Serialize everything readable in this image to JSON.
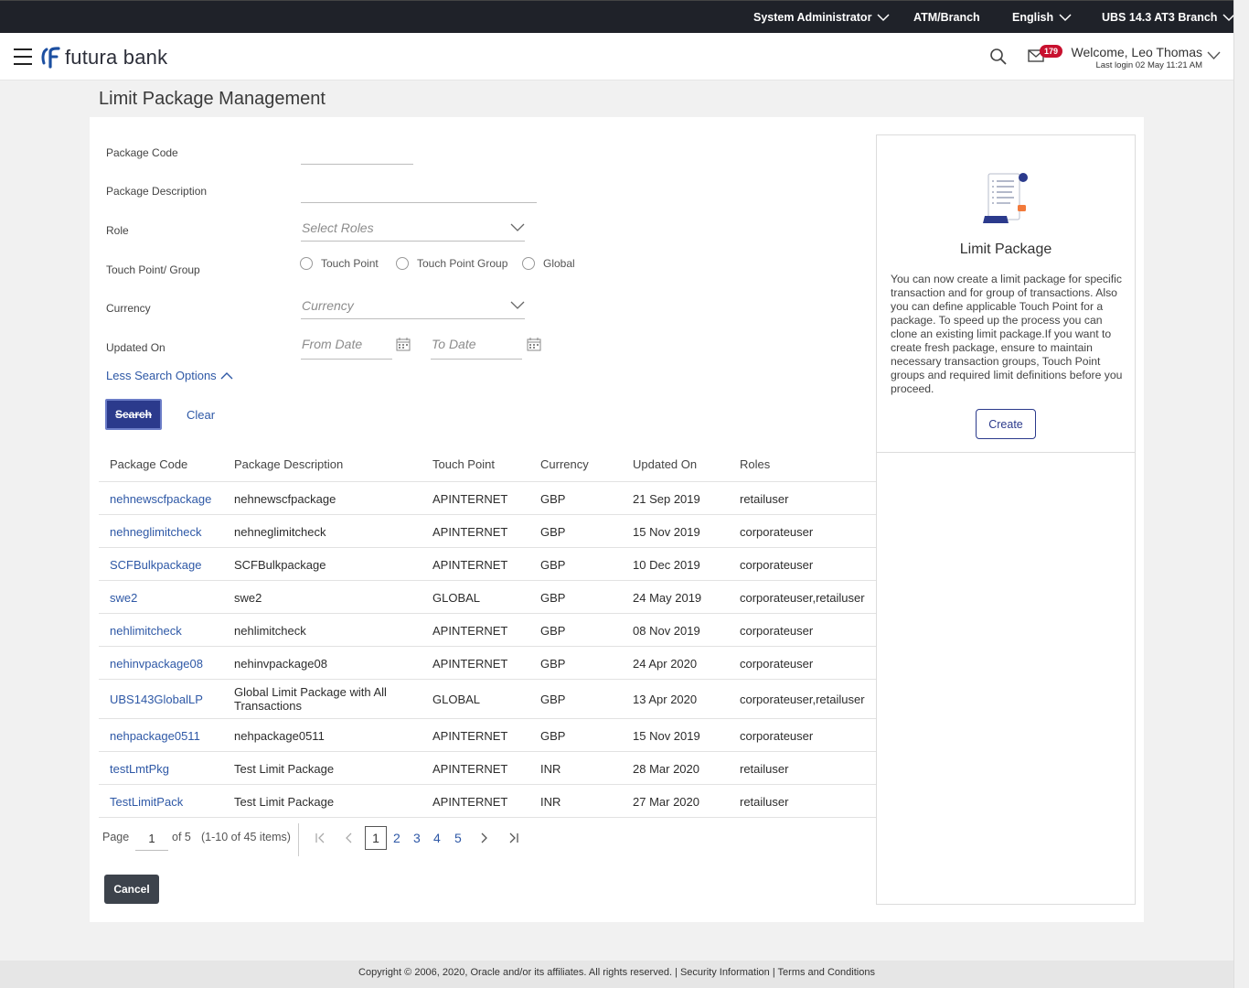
{
  "topbar": {
    "role": "System Administrator",
    "atm_branch": "ATM/Branch",
    "language": "English",
    "branch": "UBS 14.3 AT3 Branch"
  },
  "header": {
    "brand": "futura bank",
    "mail_count": "179",
    "welcome": "Welcome, Leo Thomas",
    "last_login": "Last login 02 May 11:21 AM"
  },
  "page": {
    "title": "Limit Package Management"
  },
  "form": {
    "package_code_label": "Package Code",
    "package_code_value": "",
    "package_desc_label": "Package Description",
    "package_desc_value": "",
    "role_label": "Role",
    "role_placeholder": "Select Roles",
    "touch_point_label": "Touch Point/ Group",
    "touch_point_options": [
      "Touch Point",
      "Touch Point Group",
      "Global"
    ],
    "currency_label": "Currency",
    "currency_placeholder": "Currency",
    "updated_on_label": "Updated On",
    "from_date_placeholder": "From Date",
    "to_date_placeholder": "To Date",
    "less_options": "Less Search Options",
    "search_btn": "Search",
    "clear_btn": "Clear"
  },
  "table": {
    "headers": [
      "Package Code",
      "Package Description",
      "Touch Point",
      "Currency",
      "Updated On",
      "Roles"
    ],
    "rows": [
      [
        "nehnewscfpackage",
        "nehnewscfpackage",
        "APINTERNET",
        "GBP",
        "21 Sep 2019",
        "retailuser"
      ],
      [
        "nehneglimitcheck",
        "nehneglimitcheck",
        "APINTERNET",
        "GBP",
        "15 Nov 2019",
        "corporateuser"
      ],
      [
        "SCFBulkpackage",
        "SCFBulkpackage",
        "APINTERNET",
        "GBP",
        "10 Dec 2019",
        "corporateuser"
      ],
      [
        "swe2",
        "swe2",
        "GLOBAL",
        "GBP",
        "24 May 2019",
        "corporateuser,retailuser"
      ],
      [
        "nehlimitcheck",
        "nehlimitcheck",
        "APINTERNET",
        "GBP",
        "08 Nov 2019",
        "corporateuser"
      ],
      [
        "nehinvpackage08",
        "nehinvpackage08",
        "APINTERNET",
        "GBP",
        "24 Apr 2020",
        "corporateuser"
      ],
      [
        "UBS143GlobalLP",
        "Global Limit Package with All Transactions",
        "GLOBAL",
        "GBP",
        "13 Apr 2020",
        "corporateuser,retailuser"
      ],
      [
        "nehpackage0511",
        "nehpackage0511",
        "APINTERNET",
        "GBP",
        "15 Nov 2019",
        "corporateuser"
      ],
      [
        "testLmtPkg",
        "Test Limit Package",
        "APINTERNET",
        "INR",
        "28 Mar 2020",
        "retailuser"
      ],
      [
        "TestLimitPack",
        "Test Limit Package",
        "APINTERNET",
        "INR",
        "27 Mar 2020",
        "retailuser"
      ]
    ]
  },
  "pagination": {
    "page_label": "Page",
    "current_page": "1",
    "of_label": "of 5",
    "items_info": "(1-10 of 45 items)",
    "pages": [
      "1",
      "2",
      "3",
      "4",
      "5"
    ]
  },
  "cancel_btn": "Cancel",
  "info_panel": {
    "title": "Limit Package",
    "text": "You can now create a limit package for specific transaction and for group of transactions. Also you can define applicable Touch Point for a package. To speed up the process you can clone an existing limit package.If you want to create fresh package, ensure to maintain necessary transaction groups, Touch Point groups and required limit definitions before you proceed.",
    "create_btn": "Create"
  },
  "footer": {
    "text": "Copyright © 2006, 2020, Oracle and/or its affiliates. All rights reserved. | Security Information | Terms and Conditions"
  },
  "colors": {
    "topbar_bg": "#1f2229",
    "primary": "#2b3a8c",
    "link": "#2e58a6",
    "badge": "#c8102e"
  }
}
